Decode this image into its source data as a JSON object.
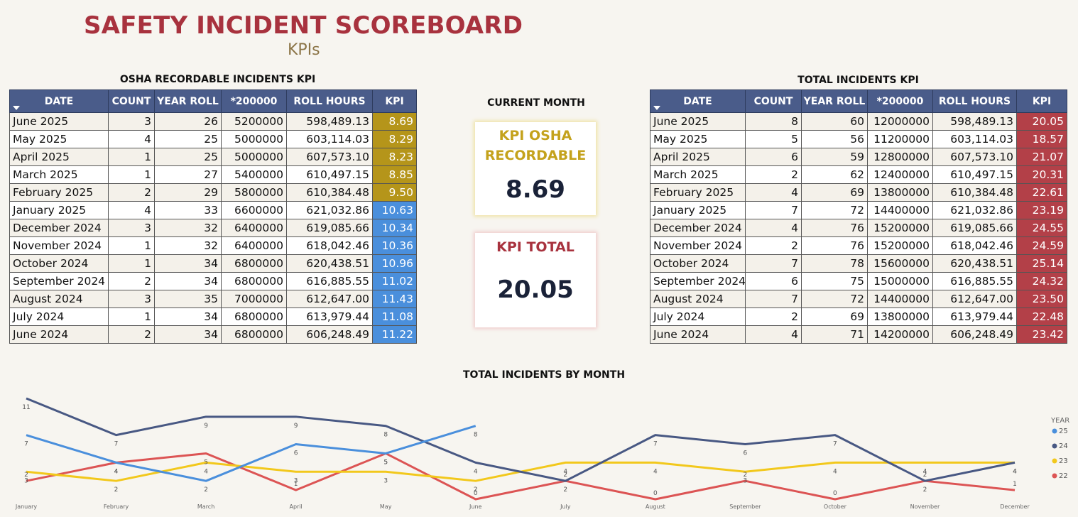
{
  "header": {
    "title": "SAFETY INCIDENT SCOREBOARD",
    "subtitle": "KPIs"
  },
  "osha": {
    "title": "OSHA RECORDABLE INCIDENTS KPI",
    "columns": [
      "DATE",
      "COUNT",
      "YEAR ROLL",
      "*200000",
      "ROLL HOURS",
      "KPI"
    ],
    "rows": [
      {
        "date": "June 2025",
        "count": "3",
        "year_roll": "26",
        "mult": "5200000",
        "roll_hours": "598,489.13",
        "kpi": "8.69",
        "band": "gold"
      },
      {
        "date": "May 2025",
        "count": "4",
        "year_roll": "25",
        "mult": "5000000",
        "roll_hours": "603,114.03",
        "kpi": "8.29",
        "band": "gold"
      },
      {
        "date": "April 2025",
        "count": "1",
        "year_roll": "25",
        "mult": "5000000",
        "roll_hours": "607,573.10",
        "kpi": "8.23",
        "band": "gold"
      },
      {
        "date": "March 2025",
        "count": "1",
        "year_roll": "27",
        "mult": "5400000",
        "roll_hours": "610,497.15",
        "kpi": "8.85",
        "band": "gold"
      },
      {
        "date": "February 2025",
        "count": "2",
        "year_roll": "29",
        "mult": "5800000",
        "roll_hours": "610,384.48",
        "kpi": "9.50",
        "band": "gold"
      },
      {
        "date": "January 2025",
        "count": "4",
        "year_roll": "33",
        "mult": "6600000",
        "roll_hours": "621,032.86",
        "kpi": "10.63",
        "band": "blue"
      },
      {
        "date": "December 2024",
        "count": "3",
        "year_roll": "32",
        "mult": "6400000",
        "roll_hours": "619,085.66",
        "kpi": "10.34",
        "band": "blue"
      },
      {
        "date": "November 2024",
        "count": "1",
        "year_roll": "32",
        "mult": "6400000",
        "roll_hours": "618,042.46",
        "kpi": "10.36",
        "band": "blue"
      },
      {
        "date": "October 2024",
        "count": "1",
        "year_roll": "34",
        "mult": "6800000",
        "roll_hours": "620,438.51",
        "kpi": "10.96",
        "band": "blue"
      },
      {
        "date": "September 2024",
        "count": "2",
        "year_roll": "34",
        "mult": "6800000",
        "roll_hours": "616,885.55",
        "kpi": "11.02",
        "band": "blue"
      },
      {
        "date": "August 2024",
        "count": "3",
        "year_roll": "35",
        "mult": "7000000",
        "roll_hours": "612,647.00",
        "kpi": "11.43",
        "band": "blue"
      },
      {
        "date": "July 2024",
        "count": "1",
        "year_roll": "34",
        "mult": "6800000",
        "roll_hours": "613,979.44",
        "kpi": "11.08",
        "band": "blue"
      },
      {
        "date": "June 2024",
        "count": "2",
        "year_roll": "34",
        "mult": "6800000",
        "roll_hours": "606,248.49",
        "kpi": "11.22",
        "band": "blue"
      }
    ]
  },
  "total": {
    "title": "TOTAL INCIDENTS KPI",
    "columns": [
      "DATE",
      "COUNT",
      "YEAR ROLL",
      "*200000",
      "ROLL HOURS",
      "KPI"
    ],
    "rows": [
      {
        "date": "June 2025",
        "count": "8",
        "year_roll": "60",
        "mult": "12000000",
        "roll_hours": "598,489.13",
        "kpi": "20.05",
        "band": "red"
      },
      {
        "date": "May 2025",
        "count": "5",
        "year_roll": "56",
        "mult": "11200000",
        "roll_hours": "603,114.03",
        "kpi": "18.57",
        "band": "red"
      },
      {
        "date": "April 2025",
        "count": "6",
        "year_roll": "59",
        "mult": "12800000",
        "roll_hours": "607,573.10",
        "kpi": "21.07",
        "band": "red"
      },
      {
        "date": "March 2025",
        "count": "2",
        "year_roll": "62",
        "mult": "12400000",
        "roll_hours": "610,497.15",
        "kpi": "20.31",
        "band": "red"
      },
      {
        "date": "February 2025",
        "count": "4",
        "year_roll": "69",
        "mult": "13800000",
        "roll_hours": "610,384.48",
        "kpi": "22.61",
        "band": "red"
      },
      {
        "date": "January 2025",
        "count": "7",
        "year_roll": "72",
        "mult": "14400000",
        "roll_hours": "621,032.86",
        "kpi": "23.19",
        "band": "red"
      },
      {
        "date": "December 2024",
        "count": "4",
        "year_roll": "76",
        "mult": "15200000",
        "roll_hours": "619,085.66",
        "kpi": "24.55",
        "band": "red"
      },
      {
        "date": "November 2024",
        "count": "2",
        "year_roll": "76",
        "mult": "15200000",
        "roll_hours": "618,042.46",
        "kpi": "24.59",
        "band": "red"
      },
      {
        "date": "October 2024",
        "count": "7",
        "year_roll": "78",
        "mult": "15600000",
        "roll_hours": "620,438.51",
        "kpi": "25.14",
        "band": "red"
      },
      {
        "date": "September 2024",
        "count": "6",
        "year_roll": "75",
        "mult": "15000000",
        "roll_hours": "616,885.55",
        "kpi": "24.32",
        "band": "red"
      },
      {
        "date": "August 2024",
        "count": "7",
        "year_roll": "72",
        "mult": "14400000",
        "roll_hours": "612,647.00",
        "kpi": "23.50",
        "band": "red"
      },
      {
        "date": "July 2024",
        "count": "2",
        "year_roll": "69",
        "mult": "13800000",
        "roll_hours": "613,979.44",
        "kpi": "22.48",
        "band": "red"
      },
      {
        "date": "June 2024",
        "count": "4",
        "year_roll": "71",
        "mult": "14200000",
        "roll_hours": "606,248.49",
        "kpi": "23.42",
        "band": "red"
      }
    ]
  },
  "current_month": {
    "label": "CURRENT MONTH",
    "osha_card": {
      "title": "KPI OSHA RECORDABLE",
      "value": "8.69"
    },
    "total_card": {
      "title": "KPI TOTAL",
      "value": "20.05"
    }
  },
  "colors": {
    "gold": "#b5951a",
    "blue": "#4a8fdc",
    "red": "#b34048",
    "header": "#4a5c8a",
    "title": "#a8323e"
  },
  "chart_data": {
    "type": "line",
    "title": "TOTAL INCIDENTS BY MONTH",
    "x": [
      "January",
      "February",
      "March",
      "April",
      "May",
      "June",
      "July",
      "August",
      "September",
      "October",
      "November",
      "December"
    ],
    "ylim": [
      0,
      11
    ],
    "grid": false,
    "legend_title": "YEAR",
    "legend_position": "right",
    "series": [
      {
        "name": "25",
        "color": "#4a8fdc",
        "values": [
          7,
          4,
          2,
          6,
          5,
          8,
          null,
          null,
          null,
          null,
          null,
          null
        ]
      },
      {
        "name": "24",
        "color": "#485883",
        "values": [
          11,
          7,
          9,
          9,
          8,
          4,
          2,
          7,
          6,
          7,
          2,
          4
        ]
      },
      {
        "name": "23",
        "color": "#f2c81c",
        "values": [
          3,
          2,
          4,
          3,
          3,
          2,
          4,
          4,
          3,
          4,
          4,
          4
        ]
      },
      {
        "name": "22",
        "color": "#dc5454",
        "values": [
          2,
          4,
          5,
          1,
          5,
          0,
          2,
          0,
          2,
          0,
          2,
          1
        ]
      }
    ]
  }
}
